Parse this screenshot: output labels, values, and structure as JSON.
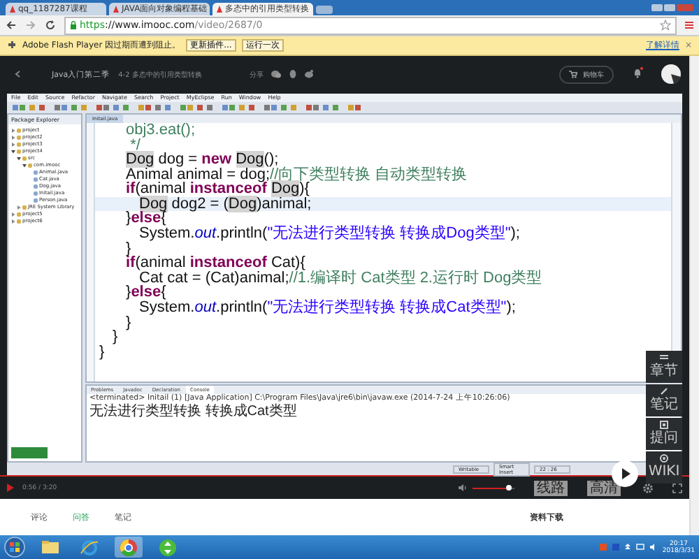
{
  "browser_tabs": [
    {
      "title": "qq_1187287课程",
      "selected": false
    },
    {
      "title": "JAVA面向对象编程基础",
      "selected": false
    },
    {
      "title": "多态中的引用类型转换",
      "selected": true
    }
  ],
  "address_bar": {
    "scheme": "https",
    "host": "://www.imooc.com",
    "path": "/video/2687/0"
  },
  "flash_bar": {
    "message": "Adobe Flash Player 因过期而遭到阻止。",
    "buttons": [
      "更新插件...",
      "运行一次"
    ],
    "link": "了解详情",
    "close": "×"
  },
  "course_header": {
    "course": "Java入门第二季",
    "lesson": "4-2 多态中的引用类型转换",
    "share": "分享",
    "cart": "购物车",
    "notification": true
  },
  "eclipse": {
    "menu": [
      "File",
      "Edit",
      "Source",
      "Refactor",
      "Navigate",
      "Search",
      "Project",
      "MyEclipse",
      "Run",
      "Window",
      "Help"
    ],
    "package_explorer": {
      "title": "Package Explorer",
      "tree": [
        {
          "label": "project",
          "expanded": false
        },
        {
          "label": "project2",
          "expanded": false
        },
        {
          "label": "project3",
          "expanded": false
        },
        {
          "label": "project4",
          "expanded": true,
          "children": [
            {
              "label": "src",
              "expanded": true,
              "children": [
                {
                  "label": "com.imooc",
                  "expanded": true,
                  "children": [
                    {
                      "label": "Animal.java"
                    },
                    {
                      "label": "Cat.java"
                    },
                    {
                      "label": "Dog.java"
                    },
                    {
                      "label": "Initail.java"
                    },
                    {
                      "label": "Person.java"
                    }
                  ]
                }
              ]
            },
            {
              "label": "JRE System Library",
              "expanded": false
            }
          ]
        },
        {
          "label": "project5",
          "expanded": false
        },
        {
          "label": "project6",
          "expanded": false
        }
      ]
    },
    "editor": {
      "tab": "Initail.java",
      "lines": [
        {
          "current": false,
          "tokens": [
            {
              "kind": "comment",
              "text": "\t\tobj3.eat();"
            }
          ]
        },
        {
          "current": false,
          "tokens": [
            {
              "kind": "comment",
              "text": "\t\t */"
            }
          ]
        },
        {
          "current": false,
          "tokens": [
            {
              "kind": "mark",
              "text": "\t\tDog"
            },
            {
              "kind": "plain",
              "text": " dog = "
            },
            {
              "kind": "keyword",
              "text": "new"
            },
            {
              "kind": "mark",
              "text": " Dog"
            },
            {
              "kind": "plain",
              "text": "();"
            }
          ]
        },
        {
          "current": false,
          "tokens": [
            {
              "kind": "plain",
              "text": "\t\tAnimal animal = dog;"
            },
            {
              "kind": "comment",
              "text": "//向下类型转换 自动类型转换"
            }
          ]
        },
        {
          "current": false,
          "tokens": [
            {
              "kind": "keyword",
              "text": "\t\tif"
            },
            {
              "kind": "plain",
              "text": "(animal "
            },
            {
              "kind": "keyword",
              "text": "instanceof"
            },
            {
              "kind": "mark",
              "text": " Dog"
            },
            {
              "kind": "plain",
              "text": "){"
            }
          ]
        },
        {
          "current": true,
          "tokens": [
            {
              "kind": "mark",
              "text": "\t\t\tDog"
            },
            {
              "kind": "plain",
              "text": " dog2 = ("
            },
            {
              "kind": "mark",
              "text": "Dog"
            },
            {
              "kind": "plain",
              "text": ")animal;"
            }
          ]
        },
        {
          "current": false,
          "tokens": [
            {
              "kind": "plain",
              "text": "\t\t}"
            },
            {
              "kind": "keyword",
              "text": "else"
            },
            {
              "kind": "plain",
              "text": "{"
            }
          ]
        },
        {
          "current": false,
          "tokens": [
            {
              "kind": "plain",
              "text": "\t\t\tSystem."
            },
            {
              "kind": "field",
              "text": "out"
            },
            {
              "kind": "plain",
              "text": ".println("
            },
            {
              "kind": "string",
              "text": "\"无法进行类型转换 转换成Dog类型\""
            },
            {
              "kind": "plain",
              "text": ");"
            }
          ]
        },
        {
          "current": false,
          "tokens": [
            {
              "kind": "plain",
              "text": "\t\t}"
            }
          ]
        },
        {
          "current": false,
          "tokens": [
            {
              "kind": "keyword",
              "text": "\t\tif"
            },
            {
              "kind": "plain",
              "text": "(animal "
            },
            {
              "kind": "keyword",
              "text": "instanceof"
            },
            {
              "kind": "plain",
              "text": " Cat){"
            }
          ]
        },
        {
          "current": false,
          "tokens": [
            {
              "kind": "plain",
              "text": "\t\t\tCat cat = (Cat)animal;"
            },
            {
              "kind": "comment",
              "text": "//1.编译时 Cat类型 2.运行时 Dog类型"
            }
          ]
        },
        {
          "current": false,
          "tokens": [
            {
              "kind": "plain",
              "text": "\t\t}"
            },
            {
              "kind": "keyword",
              "text": "else"
            },
            {
              "kind": "plain",
              "text": "{"
            }
          ]
        },
        {
          "current": false,
          "tokens": [
            {
              "kind": "plain",
              "text": "\t\t\tSystem."
            },
            {
              "kind": "field",
              "text": "out"
            },
            {
              "kind": "plain",
              "text": ".println("
            },
            {
              "kind": "string",
              "text": "\"无法进行类型转换 转换成Cat类型\""
            },
            {
              "kind": "plain",
              "text": ");"
            }
          ]
        },
        {
          "current": false,
          "tokens": [
            {
              "kind": "plain",
              "text": "\t\t}"
            }
          ]
        },
        {
          "current": false,
          "tokens": [
            {
              "kind": "plain",
              "text": "\t}"
            }
          ]
        },
        {
          "current": false,
          "tokens": [
            {
              "kind": "plain",
              "text": "}"
            }
          ]
        }
      ]
    },
    "console": {
      "tabs": [
        {
          "label": "Problems",
          "selected": false
        },
        {
          "label": "Javadoc",
          "selected": false
        },
        {
          "label": "Declaration",
          "selected": false
        },
        {
          "label": "Console",
          "selected": true
        }
      ],
      "header": "<terminated> Initail (1) [Java Application] C:\\Program Files\\Java\\jre6\\bin\\javaw.exe (2014-7-24 上午10:26:06)",
      "output": "无法进行类型转换 转换成Cat类型"
    },
    "status": [
      "Writable",
      "Smart Insert",
      "22 : 26"
    ]
  },
  "side_panel": [
    {
      "kind": "chapters",
      "label": "章节"
    },
    {
      "kind": "notes",
      "label": "笔记"
    },
    {
      "kind": "ask",
      "label": "提问"
    },
    {
      "kind": "wiki",
      "label": "WIKI"
    }
  ],
  "player": {
    "time": "0:56 / 3:20",
    "volume": {
      "level": 0.88
    },
    "buttons": [
      "线路",
      "高清"
    ]
  },
  "lesson_tabs": [
    {
      "label": "评论",
      "selected": false
    },
    {
      "label": "问答",
      "selected": true
    },
    {
      "label": "笔记",
      "selected": false
    }
  ],
  "downloads": "资料下载",
  "taskbar": {
    "apps": [
      {
        "kind": "folder",
        "active": false
      },
      {
        "kind": "ie",
        "active": false
      },
      {
        "kind": "chrome",
        "active": true
      },
      {
        "kind": "updown",
        "active": false
      }
    ],
    "time": "20:17",
    "date": "2018/3/31"
  }
}
